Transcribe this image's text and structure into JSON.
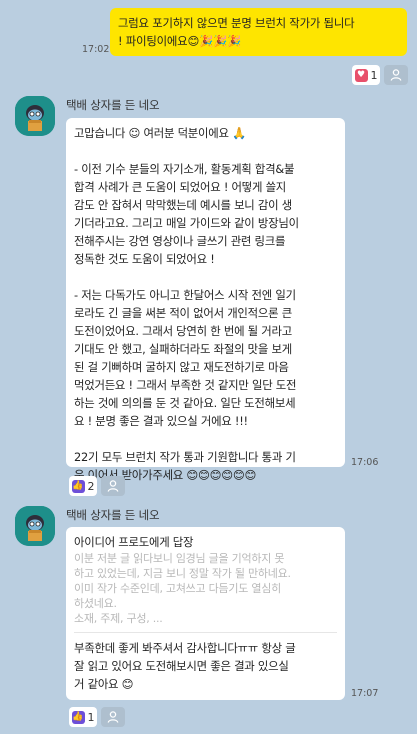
{
  "outgoing": {
    "text_line1": "그럼요 포기하지 않으면 분명 브런치 작가가 됩니다",
    "text_line2": "! 파이팅이에요😊🎉🎉🎉",
    "time": "17:02",
    "reaction_count": "1"
  },
  "messages": [
    {
      "sender": "택배 상자를 든 네오",
      "lines": [
        "고맙습니다 ☺ 여러분 덕분이에요 🙏",
        "",
        "- 이전 기수 분들의 자기소개, 활동계획 합격&불",
        "합격 사례가 큰 도움이 되었어요 ! 어떻게 쓸지",
        "감도 안 잡혀서 막막했는데 예시를 보니 감이 생",
        "기더라고요. 그리고 매일 가이드와 같이 방장님이",
        " 전해주시는 강연 영상이나 글쓰기 관련 링크를",
        "정독한 것도 도움이 되었어요 !",
        "",
        "- 저는 다독가도 아니고 한달어스 시작 전엔 일기",
        "로라도 긴 글을 써본 적이 없어서 개인적으론 큰",
        "도전이었어요. 그래서 당연히 한 번에 될 거라고",
        "기대도 안 했고, 실패하더라도 좌절의 맛을 보게",
        "된 걸 기뻐하며 굴하지 않고 재도전하기로 마음",
        "먹었거든요 ! 그래서 부족한 것 같지만 일단 도전",
        "하는 것에 의의를 둔 것 같아요. 일단 도전해보세",
        "요 ! 분명 좋은 결과 있으실 거에요 !!!",
        "",
        "22기 모두 브런치 작가 통과 기원합니다 통과 기",
        "운 이어서 받아가주세요 😊😊😊😊😊😊"
      ],
      "time": "17:06",
      "reaction_count": "2"
    },
    {
      "sender": "택배 상자를 든 네오",
      "reply_to": "아이디어 프로도에게 답장",
      "quote_lines": [
        "이분 저분 글 읽다보니 임경님  글을 기억하지 못",
        "하고 있었는데, 지금 보니 정말 작가 될 만하네요.",
        " 이미 작가 수준인데, 고쳐쓰고 다듬기도 열심히",
        "하셨네요.",
        "소재, 주제, 구성, ..."
      ],
      "lines": [
        "부족한데 좋게 봐주셔서 감사합니다ㅠㅠ 항상 글",
        " 잘 읽고 있어요 도전해보시면 좋은 결과 있으실",
        "거 같아요 😊"
      ],
      "time": "17:07",
      "reaction_count": "1"
    }
  ]
}
